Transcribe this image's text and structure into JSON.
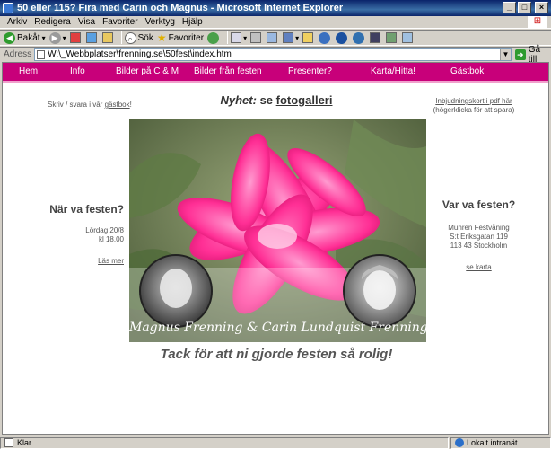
{
  "window": {
    "title": "50 eller 115? Fira med Carin och Magnus - Microsoft Internet Explorer",
    "buttons": [
      "_",
      "□",
      "×"
    ]
  },
  "menubar": {
    "items": [
      "Arkiv",
      "Redigera",
      "Visa",
      "Favoriter",
      "Verktyg",
      "Hjälp"
    ]
  },
  "toolbar": {
    "back_label": "Bakåt",
    "search_label": "Sök",
    "favorites_label": "Favoriter"
  },
  "addressbar": {
    "label": "Adress",
    "value": "W:\\_Webbplatser\\frenning.se\\50fest\\index.htm",
    "go_label": "Gå till"
  },
  "site": {
    "nav": [
      {
        "label": "Hem"
      },
      {
        "label": "Info"
      },
      {
        "label": "Bilder på C & M"
      },
      {
        "label": "Bilder från festen"
      },
      {
        "label": "Presenter?"
      },
      {
        "label": "Karta/Hitta!"
      },
      {
        "label": "Gästbok"
      }
    ],
    "write_prefix": "Skriv / svara i vår ",
    "write_link": "gästbok",
    "write_suffix": "!",
    "news_prefix": "Nyhet:",
    "news_mid": " se ",
    "news_link": "fotogalleri",
    "invite_link": "Inbjudningskort i pdf här",
    "invite_note": "(högerklicka för att spara)",
    "when_heading": "När va festen?",
    "when_line1": "Lördag 20/8",
    "when_line2": "kl 18.00",
    "when_more": "Läs mer",
    "where_heading": "Var va festen?",
    "where_line1": "Muhren Festvåning",
    "where_line2": "S:t Eriksgatan 119",
    "where_line3": "113 43 Stockholm",
    "where_map": "se karta",
    "hero_caption": "Magnus Frenning & Carin Lundquist Frenning",
    "thanks": "Tack för att ni gjorde festen så rolig!"
  },
  "statusbar": {
    "left": "Klar",
    "right": "Lokalt intranät"
  },
  "colors": {
    "nav_bg": "#c8007a",
    "flower": "#ff3d9a"
  }
}
